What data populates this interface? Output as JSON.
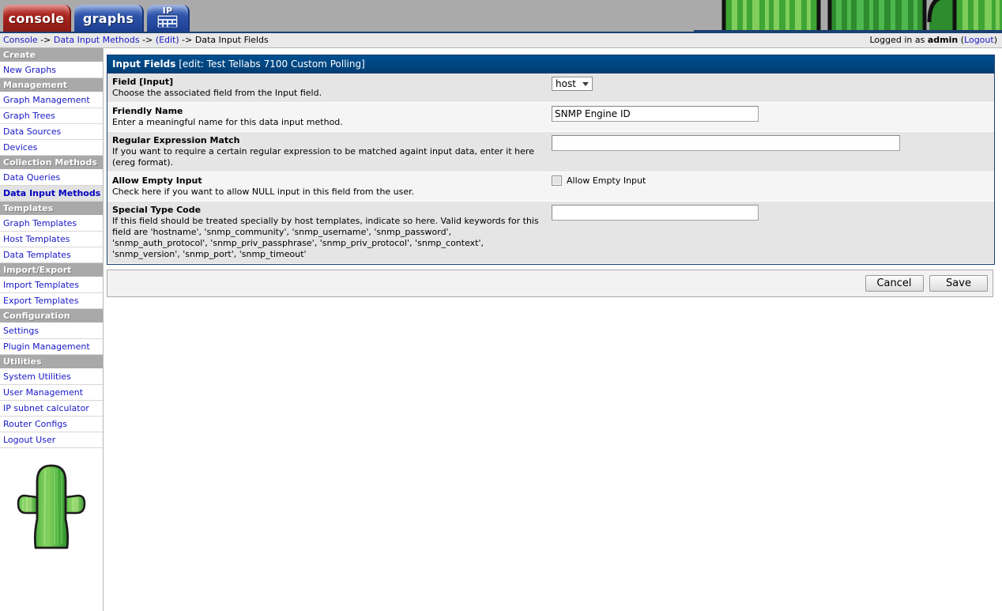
{
  "app": {
    "tabs": [
      {
        "id": "console",
        "label": "console"
      },
      {
        "id": "graphs",
        "label": "graphs"
      },
      {
        "id": "ip-calculator",
        "label": "IP"
      }
    ]
  },
  "breadcrumb": {
    "items": [
      {
        "label": "Console",
        "link": true
      },
      {
        "label": "Data Input Methods",
        "link": true
      },
      {
        "label": "(Edit)",
        "link": true
      },
      {
        "label": "Data Input Fields",
        "link": false
      }
    ],
    "separator": "->"
  },
  "session": {
    "prefix": "Logged in as",
    "user": "admin",
    "logout_open": "(",
    "logout_label": "Logout",
    "logout_close": ")"
  },
  "sidebar": {
    "groups": [
      {
        "header": "Create",
        "items": [
          {
            "label": "New Graphs",
            "selected": false
          }
        ]
      },
      {
        "header": "Management",
        "items": [
          {
            "label": "Graph Management",
            "selected": false
          },
          {
            "label": "Graph Trees",
            "selected": false
          },
          {
            "label": "Data Sources",
            "selected": false
          },
          {
            "label": "Devices",
            "selected": false
          }
        ]
      },
      {
        "header": "Collection Methods",
        "items": [
          {
            "label": "Data Queries",
            "selected": false
          },
          {
            "label": "Data Input Methods",
            "selected": true
          }
        ]
      },
      {
        "header": "Templates",
        "items": [
          {
            "label": "Graph Templates",
            "selected": false
          },
          {
            "label": "Host Templates",
            "selected": false
          },
          {
            "label": "Data Templates",
            "selected": false
          }
        ]
      },
      {
        "header": "Import/Export",
        "items": [
          {
            "label": "Import Templates",
            "selected": false
          },
          {
            "label": "Export Templates",
            "selected": false
          }
        ]
      },
      {
        "header": "Configuration",
        "items": [
          {
            "label": "Settings",
            "selected": false
          },
          {
            "label": "Plugin Management",
            "selected": false
          }
        ]
      },
      {
        "header": "Utilities",
        "items": [
          {
            "label": "System Utilities",
            "selected": false
          },
          {
            "label": "User Management",
            "selected": false
          },
          {
            "label": "IP subnet calculator",
            "selected": false
          },
          {
            "label": "Router Configs",
            "selected": false
          },
          {
            "label": "Logout User",
            "selected": false
          }
        ]
      }
    ],
    "logo_name": "cactus-logo"
  },
  "panel": {
    "title_main": "Input Fields",
    "title_sub": "[edit: Test Tellabs 7100 Custom Polling]",
    "rows": [
      {
        "label": "Field [Input]",
        "desc": "Choose the associated field from the Input field.",
        "control": "select",
        "value": "host"
      },
      {
        "label": "Friendly Name",
        "desc": "Enter a meaningful name for this data input method.",
        "control": "text",
        "value": "SNMP Engine ID",
        "placeholder": ""
      },
      {
        "label": "Regular Expression Match",
        "desc": "If you want to require a certain regular expression to be matched againt input data, enter it here (ereg format).",
        "control": "text",
        "value": "",
        "placeholder": ""
      },
      {
        "label": "Allow Empty Input",
        "desc": "Check here if you want to allow NULL input in this field from the user.",
        "control": "checkbox",
        "checkbox_label": "Allow Empty Input",
        "checked": false
      },
      {
        "label": "Special Type Code",
        "desc": "If this field should be treated specially by host templates, indicate so here. Valid keywords for this field are 'hostname', 'snmp_community', 'snmp_username', 'snmp_password', 'snmp_auth_protocol', 'snmp_priv_passphrase', 'snmp_priv_protocol', 'snmp_context', 'snmp_version', 'snmp_port', 'snmp_timeout'",
        "control": "text",
        "value": "",
        "placeholder": ""
      }
    ]
  },
  "actions": {
    "cancel_label": "Cancel",
    "save_label": "Save"
  },
  "colors": {
    "tab_console": "#a5231c",
    "tab_graphs": "#2c51a8",
    "panel_title_bg": "#00437c",
    "panel_border": "#1b3f73",
    "link": "#1818c8",
    "nav_header_bg": "#a9a9a9",
    "row_odd": "#e5e5e5",
    "row_even": "#f5f5f5",
    "topbar_bg": "#aaaaaa",
    "cactus_green": "#3fa535"
  }
}
